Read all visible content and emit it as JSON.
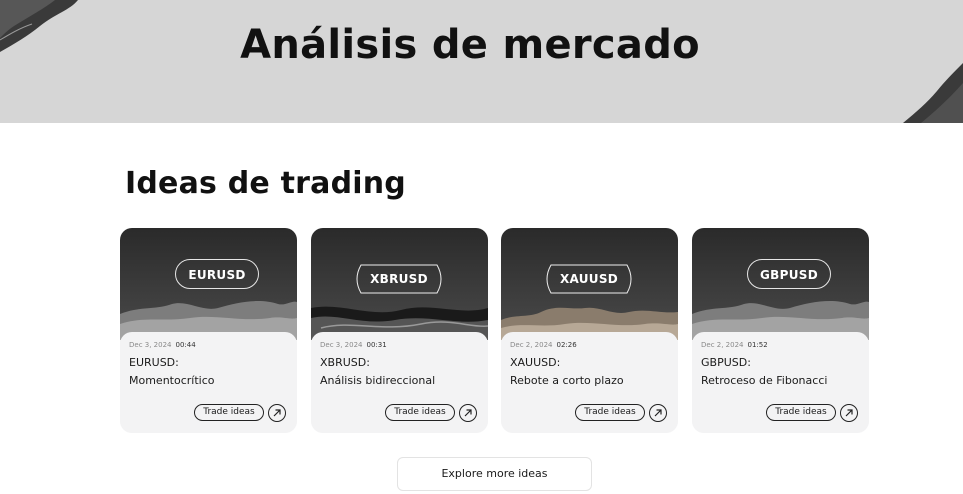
{
  "hero": {
    "title": "Análisis de mercado"
  },
  "section": {
    "title": "Ideas de trading"
  },
  "cards": [
    {
      "symbol_badge": "EURUSD",
      "badge_shape": "pill",
      "date": "Dec 3, 2024",
      "time": "00:44",
      "symbol": "EURUSD:",
      "title": "Momentocrítico",
      "button": "Trade ideas"
    },
    {
      "symbol_badge": "XBRUSD",
      "badge_shape": "diamond",
      "date": "Dec 3, 2024",
      "time": "00:31",
      "symbol": "XBRUSD:",
      "title": "Análisis bidireccional",
      "button": "Trade ideas"
    },
    {
      "symbol_badge": "XAUUSD",
      "badge_shape": "diamond",
      "date": "Dec 2, 2024",
      "time": "02:26",
      "symbol": "XAUUSD:",
      "title": "Rebote a corto plazo",
      "button": "Trade ideas"
    },
    {
      "symbol_badge": "GBPUSD",
      "badge_shape": "pill",
      "date": "Dec 2, 2024",
      "time": "01:52",
      "symbol": "GBPUSD:",
      "title": "Retroceso de Fibonacci",
      "button": "Trade ideas"
    }
  ],
  "explore": {
    "label": "Explore more ideas"
  },
  "icons": {
    "card_action": "arrow-up-right-icon"
  }
}
